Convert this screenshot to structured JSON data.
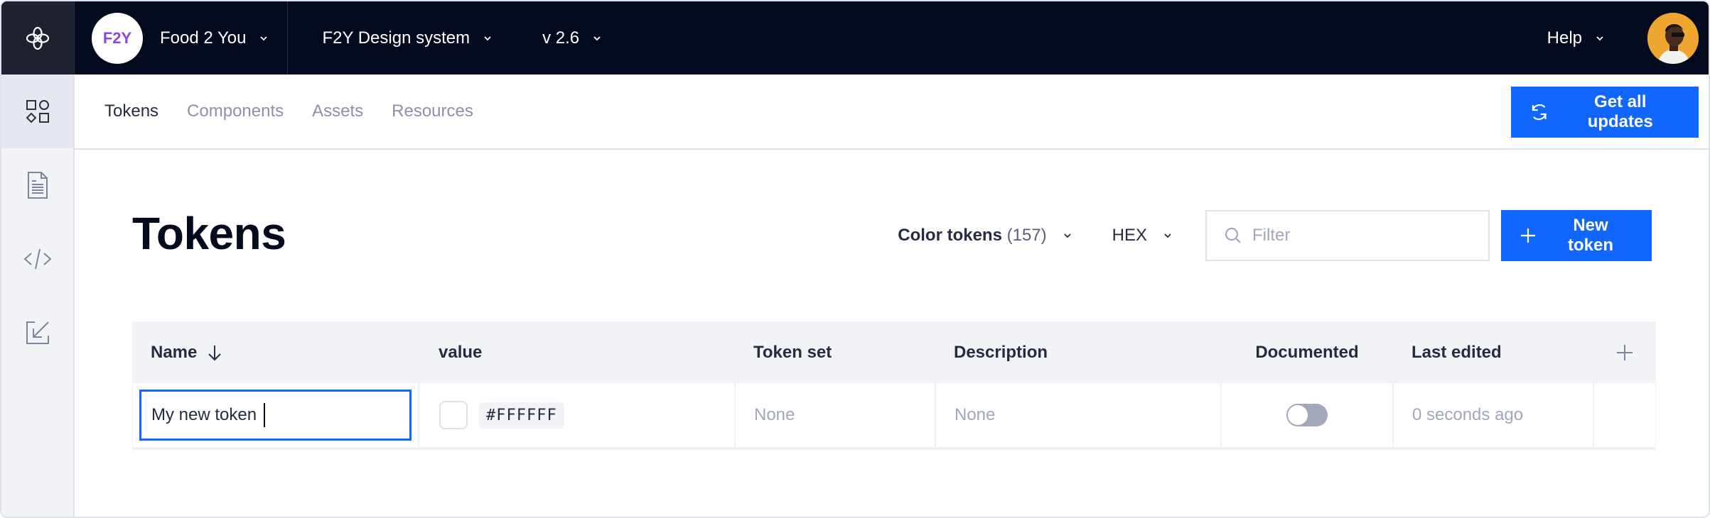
{
  "topbar": {
    "logo_icon": "flower-logo-icon",
    "org": {
      "badge": "F2Y",
      "name": "Food 2 You",
      "badge_color": "#8b46e6"
    },
    "project": "F2Y Design system",
    "version": "v 2.6",
    "help": "Help",
    "avatar_icon": "user-avatar"
  },
  "sidebar": {
    "items": [
      {
        "icon": "shapes-icon",
        "active": true
      },
      {
        "icon": "document-icon",
        "active": false
      },
      {
        "icon": "code-icon",
        "active": false
      },
      {
        "icon": "import-icon",
        "active": false
      }
    ]
  },
  "subnav": {
    "tabs": [
      {
        "label": "Tokens",
        "active": true
      },
      {
        "label": "Components",
        "active": false
      },
      {
        "label": "Assets",
        "active": false
      },
      {
        "label": "Resources",
        "active": false
      }
    ],
    "updates_button": "Get all updates"
  },
  "main": {
    "title": "Tokens",
    "token_type": {
      "label": "Color tokens",
      "count": "(157)"
    },
    "format": "HEX",
    "filter": {
      "placeholder": "Filter",
      "value": ""
    },
    "new_button": "New token"
  },
  "table": {
    "columns": [
      "Name",
      "value",
      "Token set",
      "Description",
      "Documented",
      "Last edited"
    ],
    "sort_column": "Name",
    "sort_direction": "descending",
    "rows": [
      {
        "name": "My new token",
        "value": "#FFFFFF",
        "swatch_color": "#FFFFFF",
        "token_set": "None",
        "description": "None",
        "documented": false,
        "last_edited": "0 seconds ago"
      }
    ]
  },
  "colors": {
    "accent": "#1066ff",
    "topbar_bg": "#050b1e",
    "muted_text": "#a3a7ba"
  }
}
